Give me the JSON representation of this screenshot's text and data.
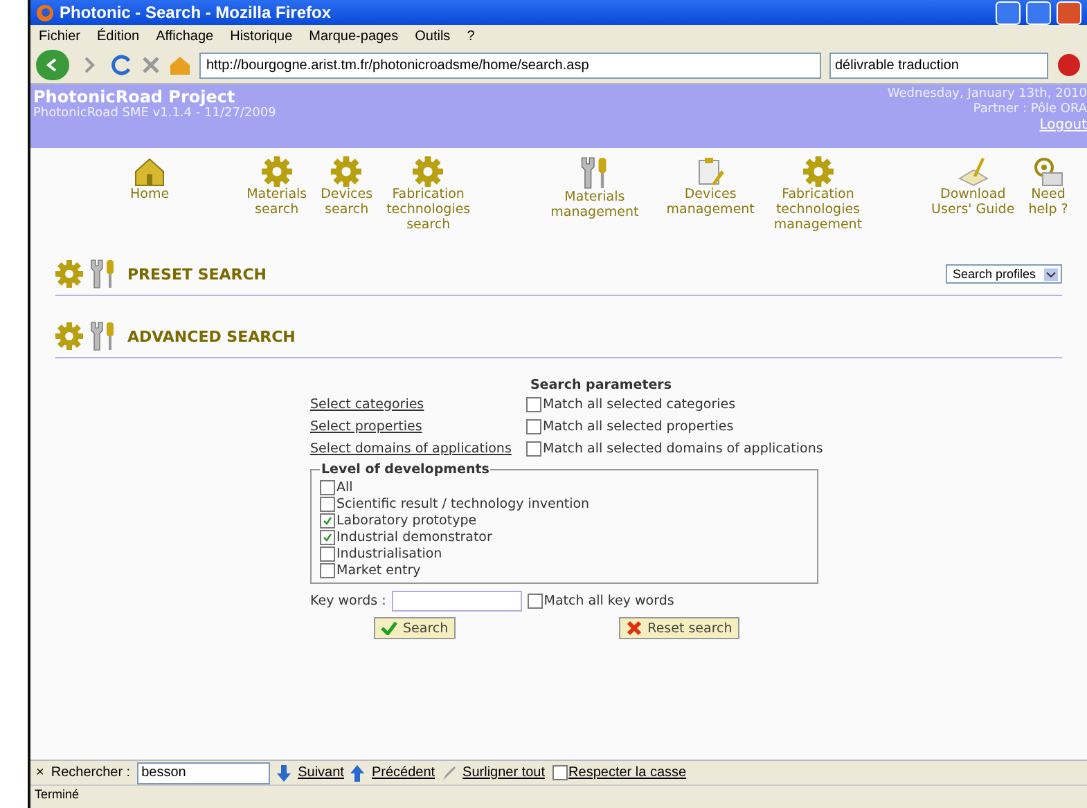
{
  "window": {
    "title": "Photonic - Search - Mozilla Firefox"
  },
  "menu": [
    "Fichier",
    "Édition",
    "Affichage",
    "Historique",
    "Marque-pages",
    "Outils",
    "?"
  ],
  "toolbar": {
    "url": "http://bourgogne.arist.tm.fr/photonicroadsme/home/search.asp",
    "search_value": "délivrable traduction"
  },
  "header": {
    "project": "PhotonicRoad Project",
    "version": "PhotonicRoad SME v1.1.4 - 11/27/2009",
    "date": "Wednesday, January 13th, 2010",
    "partner": "Partner : Pôle ORA",
    "logout": "Logout"
  },
  "nav": [
    {
      "label": "Home",
      "kind": "home"
    },
    {
      "label": "Materials\nsearch",
      "kind": "gear"
    },
    {
      "label": "Devices\nsearch",
      "kind": "gear"
    },
    {
      "label": "Fabrication\ntechnologies\nsearch",
      "kind": "gear"
    },
    {
      "label": "Materials\nmanagement",
      "kind": "tools"
    },
    {
      "label": "Devices\nmanagement",
      "kind": "clipboard"
    },
    {
      "label": "Fabrication\ntechnologies\nmanagement",
      "kind": "gear"
    },
    {
      "label": "Download\nUsers' Guide",
      "kind": "download"
    },
    {
      "label": "Need\nhelp ?",
      "kind": "help"
    }
  ],
  "preset": {
    "title": "PRESET SEARCH",
    "dropdown": "Search profiles"
  },
  "advanced": {
    "title": "ADVANCED SEARCH"
  },
  "params": {
    "heading": "Search parameters",
    "rows": [
      {
        "link": "Select categories",
        "match": "Match all selected categories",
        "checked": false
      },
      {
        "link": "Select properties",
        "match": "Match all selected properties",
        "checked": false
      },
      {
        "link": "Select domains of applications",
        "match": "Match all selected domains of applications",
        "checked": false
      }
    ],
    "legend": "Level of developments",
    "levels": [
      {
        "label": "All",
        "checked": false
      },
      {
        "label": "Scientific result / technology invention",
        "checked": false
      },
      {
        "label": "Laboratory prototype",
        "checked": true
      },
      {
        "label": "Industrial demonstrator",
        "checked": true
      },
      {
        "label": "Industrialisation",
        "checked": false
      },
      {
        "label": "Market entry",
        "checked": false
      }
    ],
    "keywords_label": "Key words :",
    "keywords_match": {
      "label": "Match all key words",
      "checked": false
    },
    "search_button": "Search",
    "reset_button": "Reset search"
  },
  "findbar": {
    "close": "×",
    "label": "Rechercher :",
    "value": "besson",
    "next": "Suivant",
    "previous": "Précédent",
    "highlight": "Surligner tout",
    "match_case": {
      "label": "Respecter la casse",
      "checked": false
    }
  },
  "status": "Terminé"
}
